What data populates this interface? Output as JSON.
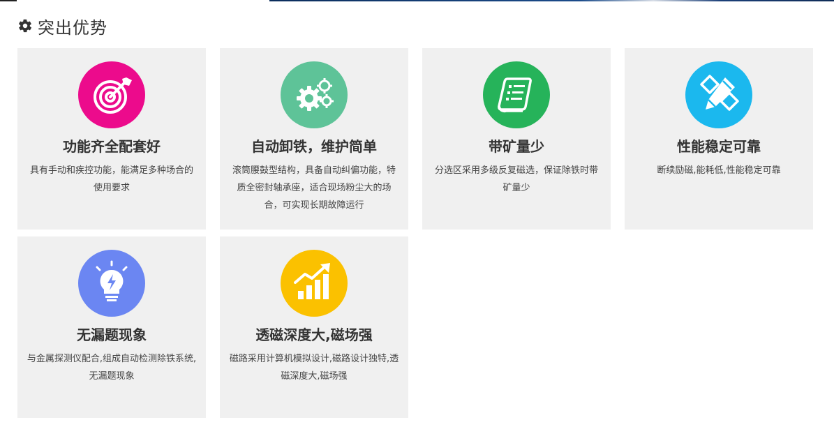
{
  "section": {
    "title": "突出优势",
    "icon": "gear-icon"
  },
  "colors": {
    "card_bg": "#f0f0f0",
    "icon_pink": "#ec0b8c",
    "icon_teal": "#5ec398",
    "icon_green": "#26b35a",
    "icon_blue": "#1bb8ee",
    "icon_periwinkle": "#6b86f2",
    "icon_yellow": "#fbc100"
  },
  "cards": [
    {
      "icon": "target-icon",
      "title": "功能齐全配套好",
      "desc": "具有手动和疾控功能，能满足多种场合的使用要求"
    },
    {
      "icon": "gears-icon",
      "title": "自动卸铁，维护简单",
      "desc": "滚筒腰鼓型结构，具备自动纠偏功能，特质全密封轴承座，适合现场粉尘大的场合，可实现长期故障运行"
    },
    {
      "icon": "document-icon",
      "title": "带矿量少",
      "desc": "分选区采用多级反复磁选，保证除铁时带矿量少"
    },
    {
      "icon": "pencil-ruler-icon",
      "title": "性能稳定可靠",
      "desc": "断续励磁,能耗低,性能稳定可靠"
    },
    {
      "icon": "lightbulb-icon",
      "title": "无漏题现象",
      "desc": "与金属探测仪配合,组成自动检测除铁系统,无漏题现象"
    },
    {
      "icon": "growth-chart-icon",
      "title": "透磁深度大,磁场强",
      "desc": "磁路采用计算机模拟设计,磁路设计独特,透磁深度大,磁场强"
    }
  ]
}
